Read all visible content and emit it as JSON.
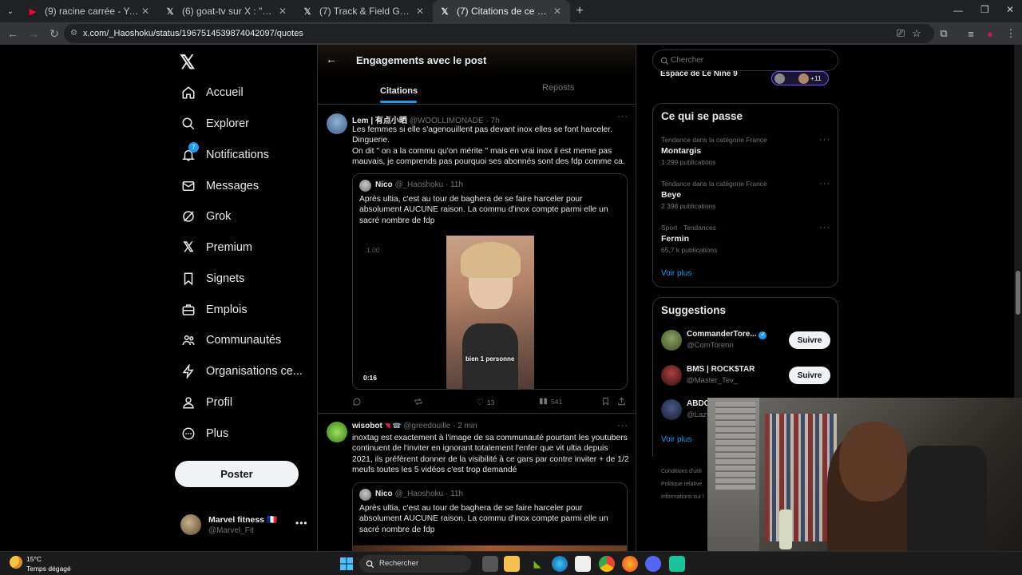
{
  "tabs": [
    {
      "title": "(9) racine carrée - YouTube",
      "icon": "youtube-icon"
    },
    {
      "title": "(6) goat-tv sur X : \"Dinguerie !",
      "icon": "x-icon"
    },
    {
      "title": "(7) Track & Field Gazette sur X",
      "icon": "x-icon"
    },
    {
      "title": "(7) Citations de ce post / X",
      "icon": "x-icon"
    }
  ],
  "url": "x.com/_Haoshoku/status/1967514539874042097/quotes",
  "nav": {
    "items": [
      "Accueil",
      "Explorer",
      "Notifications",
      "Messages",
      "Grok",
      "Premium",
      "Signets",
      "Emplois",
      "Communautés",
      "Organisations ce...",
      "Profil",
      "Plus"
    ],
    "notif_badge": "7",
    "post_button": "Poster",
    "account_name": "Marvel fitness 🇫🇷",
    "account_handle": "@Marvel_Fit"
  },
  "header": {
    "title": "Engagements avec le post",
    "tab_citations": "Citations",
    "tab_reposts": "Reposts"
  },
  "post1": {
    "name": "Lem | 有点小晒",
    "handle": "@WOOLLIMONADE",
    "time": "· 7h",
    "line1": "Les femmes si elle s'agenouillent pas devant inox elles se font harceler.",
    "line2": "Dinguerie.",
    "line3": "On dit \" on a la commu qu'on mérite \" mais en vrai inox il est meme pas mauvais, je comprends pas pourquoi ses abonnés sont des fdp comme ca.",
    "quote_name": "Nico",
    "quote_handle": "@_Haoshoku",
    "quote_time": "· 11h",
    "quote_text": "Après ultia, c'est au tour de baghera de se faire harceler pour absolument AUCUNE raison. La commu d'inox compte parmi elle un sacré nombre de fdp",
    "video_speed": "1.00",
    "video_time": "0:16",
    "video_caption": "bien 1 personne",
    "likes": "13",
    "views": "541"
  },
  "post2": {
    "name": "wisobot",
    "handle": "@greedouille",
    "time": "· 2 min",
    "text": "inoxtag est exactement à l'image de sa communauté pourtant les youtubers continuent de l'inviter en ignorant totalement l'enfer que vit ultia depuis 2021, ils préfèrent donner de la visibilité à ce gars par contre inviter + de 1/2 meufs toutes les 5 vidéos c'est trop demandé",
    "quote_name": "Nico",
    "quote_handle": "@_Haoshoku",
    "quote_time": "· 11h",
    "quote_text": "Après ultia, c'est au tour de baghera de se faire harceler pour absolument AUCUNE raison. La commu d'inox compte parmi elle un sacré nombre de fdp"
  },
  "search": {
    "placeholder": "Chercher"
  },
  "space": {
    "label": "Espace de Le Nine 9",
    "count": "+11"
  },
  "trends": {
    "title": "Ce qui se passe",
    "items": [
      {
        "cat": "Tendance dans la catégorie France",
        "name": "Montargis",
        "count": "1 299 publications"
      },
      {
        "cat": "Tendance dans la catégorie France",
        "name": "Beye",
        "count": "2 398 publications"
      },
      {
        "cat": "Sport · Tendances",
        "name": "Fermin",
        "count": "65,7 k publications"
      }
    ],
    "more": "Voir plus"
  },
  "suggestions": {
    "title": "Suggestions",
    "items": [
      {
        "name": "CommanderTore...",
        "handle": "@ComTorenn"
      },
      {
        "name": "BMS | ROCK$TAR",
        "handle": "@Master_Tev_"
      },
      {
        "name": "ABDO",
        "handle": "@Lazy"
      }
    ],
    "follow": "Suivre",
    "more": "Voir plus"
  },
  "footer_links": [
    "Conditions d'utili",
    "Politique relative",
    "Informations sur l"
  ],
  "taskbar": {
    "temp": "15°C",
    "weather": "Temps dégagé",
    "search": "Rechercher"
  }
}
